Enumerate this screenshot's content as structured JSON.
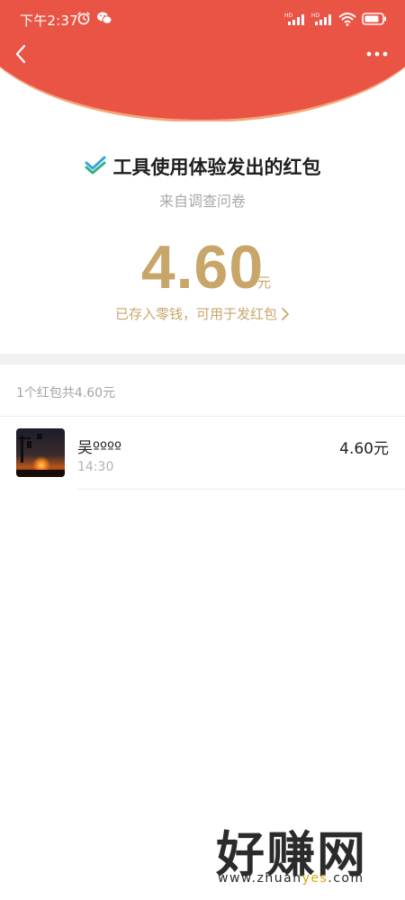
{
  "colors": {
    "header_red": "#ea5445",
    "gold": "#c8a66a",
    "muted_text": "#a9a9a9",
    "watermark_accent": "#e2a400"
  },
  "status_bar": {
    "time": "下午2:37",
    "icons": [
      "alarm-icon",
      "wechat-icon",
      "hd-signal-icon",
      "hd-signal-icon",
      "wifi-icon",
      "battery-icon"
    ],
    "hd_label": "HD"
  },
  "nav": {
    "back_icon": "chevron-left-icon",
    "more_icon": "more-dots-icon"
  },
  "envelope": {
    "title": "工具使用体验发出的红包",
    "source": "来自调查问卷",
    "amount": "4.60",
    "unit": "元",
    "stored_text": "已存入零钱，可用于发红包"
  },
  "summary": "1个红包共4.60元",
  "records": [
    {
      "name": "吴ºººº",
      "time": "14:30",
      "amount": "4.60元"
    }
  ],
  "watermark": {
    "big": "好赚网",
    "url_prefix": "www.zhuan",
    "url_accent": "yes",
    "url_suffix": ".com"
  }
}
